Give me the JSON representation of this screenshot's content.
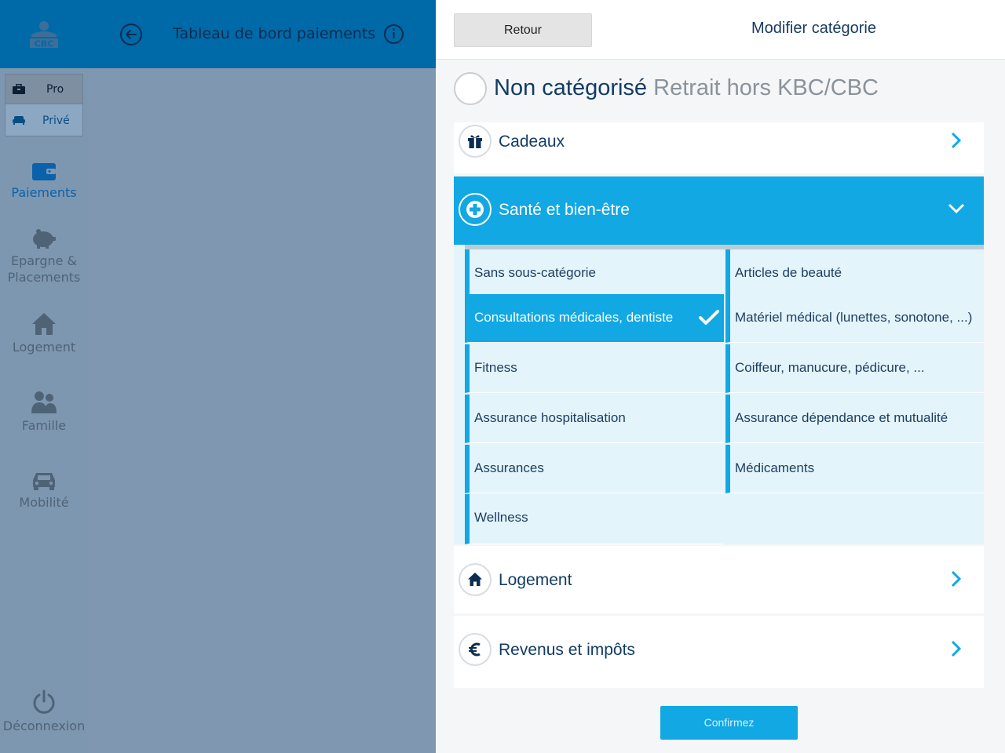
{
  "sidebar": {
    "logo_text": "CBC",
    "switch": {
      "pro": "Pro",
      "prive": "Privé"
    },
    "items": [
      {
        "label": "Paiements",
        "icon": "wallet-icon"
      },
      {
        "label": "Epargne & Placements",
        "icon": "piggy-bank-icon"
      },
      {
        "label": "Logement",
        "icon": "house-icon"
      },
      {
        "label": "Famille",
        "icon": "family-icon"
      },
      {
        "label": "Mobilité",
        "icon": "car-icon"
      }
    ],
    "logout": "Déconnexion"
  },
  "header": {
    "title": "Tableau de bord paiements"
  },
  "panel": {
    "back_label": "Retour",
    "title": "Modifier catégorie",
    "uncategorized": {
      "label": "Non catégorisé",
      "sub": "Retrait hors KBC/CBC"
    },
    "categories": [
      {
        "label": "Cadeaux",
        "icon": "gift-icon"
      },
      {
        "label": "Santé et bien-être",
        "icon": "health-plus-icon",
        "expanded": true
      },
      {
        "label": "Logement",
        "icon": "house-icon"
      },
      {
        "label": "Revenus et impôts",
        "icon": "euro-icon"
      }
    ],
    "subcategories": {
      "left": [
        "Sans sous-catégorie",
        "Consultations médicales, dentiste",
        "Fitness",
        "Assurance hospitalisation",
        "Assurances",
        "Wellness"
      ],
      "right": [
        "Articles de beauté",
        "Matériel médical (lunettes, sonotone, ...)",
        "Coiffeur, manucure, pédicure, ...",
        "Assurance dépendance et mutualité",
        "Médicaments"
      ],
      "selected": "Consultations médicales, dentiste"
    },
    "confirm_label": "Confirmez"
  },
  "colors": {
    "accent": "#11a8e4",
    "header_blue": "#0069a8",
    "dim": "#7f97b0",
    "text_navy": "#123c66"
  }
}
